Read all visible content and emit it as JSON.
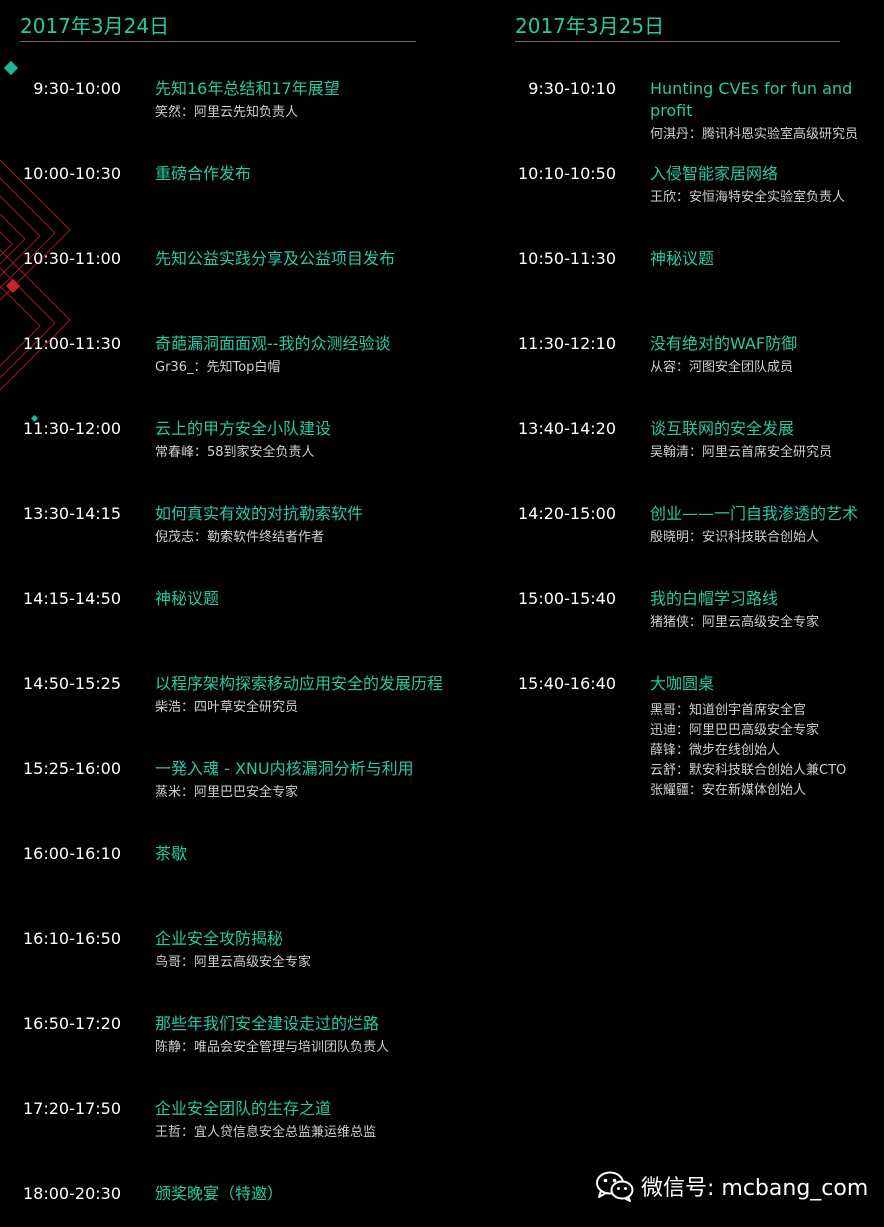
{
  "colors": {
    "background": "#000000",
    "accent": "#27c9a3",
    "time_text": "#ffffff",
    "speaker_text": "#cfcfcf",
    "deco_red": "#b81e2a",
    "deco_teal": "#1fb79a"
  },
  "day1": {
    "title": "2017年3月24日",
    "sessions": [
      {
        "time": "9:30-10:00",
        "title": "先知16年总结和17年展望",
        "speaker": "笑然：阿里云先知负责人"
      },
      {
        "time": "10:00-10:30",
        "title": "重磅合作发布",
        "speaker": ""
      },
      {
        "time": "10:30-11:00",
        "title": "先知公益实践分享及公益项目发布",
        "speaker": ""
      },
      {
        "time": "11:00-11:30",
        "title": "奇葩漏洞面面观--我的众测经验谈",
        "speaker": "Gr36_：先知Top白帽"
      },
      {
        "time": "11:30-12:00",
        "title": "云上的甲方安全小队建设",
        "speaker": "常春峰：58到家安全负责人"
      },
      {
        "time": "13:30-14:15",
        "title": "如何真实有效的对抗勒索软件",
        "speaker": "倪茂志：勒索软件终结者作者"
      },
      {
        "time": "14:15-14:50",
        "title": "神秘议题",
        "speaker": ""
      },
      {
        "time": "14:50-15:25",
        "title": "以程序架构探索移动应用安全的发展历程",
        "speaker": "柴浩：四叶草安全研究员"
      },
      {
        "time": "15:25-16:00",
        "title": "一発入魂 - XNU内核漏洞分析与利用",
        "speaker": "蒸米：阿里巴巴安全专家"
      },
      {
        "time": "16:00-16:10",
        "title": "茶歇",
        "speaker": ""
      },
      {
        "time": "16:10-16:50",
        "title": "企业安全攻防揭秘",
        "speaker": "鸟哥：阿里云高级安全专家"
      },
      {
        "time": "16:50-17:20",
        "title": "那些年我们安全建设走过的烂路",
        "speaker": "陈静：唯品会安全管理与培训团队负责人"
      },
      {
        "time": "17:20-17:50",
        "title": "企业安全团队的生存之道",
        "speaker": "王哲：宜人贷信息安全总监兼运维总监"
      },
      {
        "time": "18:00-20:30",
        "title": "颁奖晚宴（特邀）",
        "speaker": ""
      }
    ]
  },
  "day2": {
    "title": "2017年3月25日",
    "sessions": [
      {
        "time": "9:30-10:10",
        "title": "Hunting CVEs for fun and profit",
        "speaker": "何淇丹：腾讯科恩实验室高级研究员"
      },
      {
        "time": "10:10-10:50",
        "title": "入侵智能家居网络",
        "speaker": "王欣：安恒海特安全实验室负责人"
      },
      {
        "time": "10:50-11:30",
        "title": "神秘议题",
        "speaker": ""
      },
      {
        "time": "11:30-12:10",
        "title": "没有绝对的WAF防御",
        "speaker": "从容：河图安全团队成员"
      },
      {
        "time": "13:40-14:20",
        "title": "谈互联网的安全发展",
        "speaker": "吴翰清：阿里云首席安全研究员"
      },
      {
        "time": "14:20-15:00",
        "title": "创业——一门自我渗透的艺术",
        "speaker": "殷晓明：安识科技联合创始人"
      },
      {
        "time": "15:00-15:40",
        "title": "我的白帽学习路线",
        "speaker": "猪猪侠：阿里云高级安全专家"
      },
      {
        "time": "15:40-16:40",
        "title": "大咖圆桌",
        "speaker": ""
      }
    ],
    "panelists": [
      "黑哥：知道创宇首席安全官",
      "迅迪：阿里巴巴高级安全专家",
      "薛锋：微步在线创始人",
      "云舒：默安科技联合创始人兼CTO",
      "张耀疆：安在新媒体创始人"
    ]
  },
  "watermark": {
    "icon": "wechat-icon",
    "text": "微信号: mcbang_com"
  }
}
